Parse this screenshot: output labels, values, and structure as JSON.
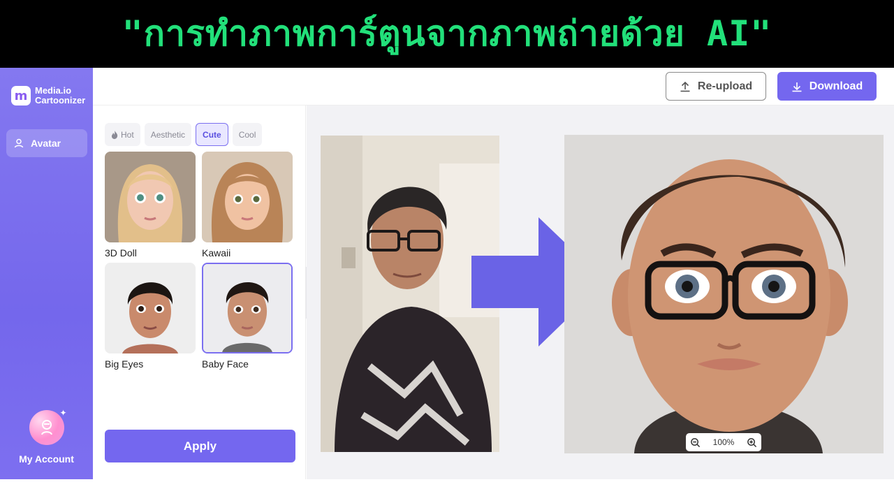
{
  "banner": {
    "title": "\"การทำภาพการ์ตูนจากภาพถ่ายด้วย AI\""
  },
  "app": {
    "logo": {
      "mark": "m",
      "line1": "Media.io",
      "line2": "Cartoonizer"
    },
    "nav": {
      "avatar_label": "Avatar",
      "account_label": "My Account"
    },
    "toolbar": {
      "reupload_label": "Re-upload",
      "download_label": "Download"
    },
    "tabs": [
      {
        "label": "Hot"
      },
      {
        "label": "Aesthetic"
      },
      {
        "label": "Cute",
        "active": true
      },
      {
        "label": "Cool"
      }
    ],
    "styles": [
      {
        "label": "3D Doll"
      },
      {
        "label": "Kawaii"
      },
      {
        "label": "Big Eyes"
      },
      {
        "label": "Baby Face",
        "selected": true
      }
    ],
    "apply_label": "Apply",
    "zoom": {
      "level": "100%"
    },
    "colors": {
      "accent": "#7467ef",
      "banner_text": "#22e07a",
      "banner_bg": "#000000"
    }
  }
}
